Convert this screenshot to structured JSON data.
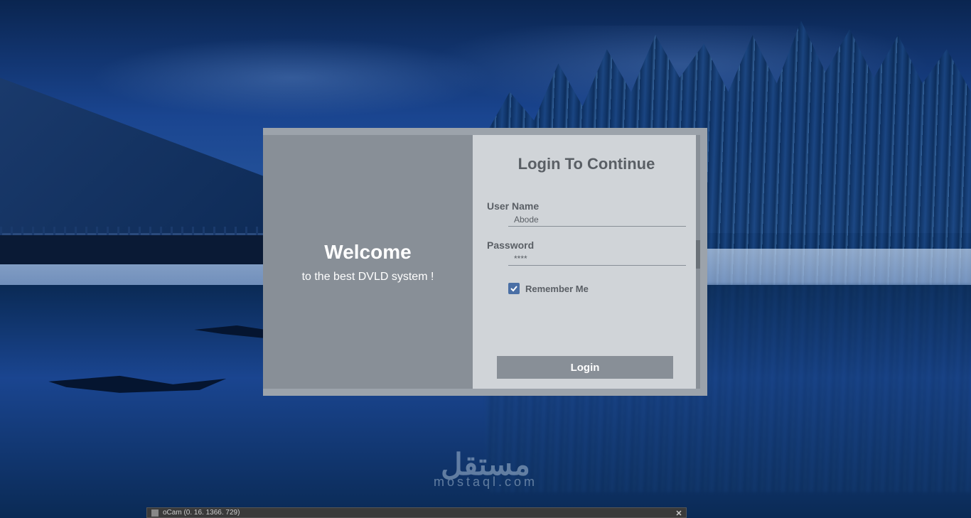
{
  "welcome": {
    "title": "Welcome",
    "subtitle": "to the best DVLD system !"
  },
  "login": {
    "title": "Login To Continue",
    "username_label": "User Name",
    "username_value": "Abode",
    "password_label": "Password",
    "password_value": "****",
    "remember_label": "Remember Me",
    "remember_checked": true,
    "button_label": "Login"
  },
  "watermark": {
    "arabic": "مستقل",
    "latin": "mostaql.com"
  },
  "taskbar": {
    "app_title": "oCam (0. 16. 1366. 729)"
  }
}
